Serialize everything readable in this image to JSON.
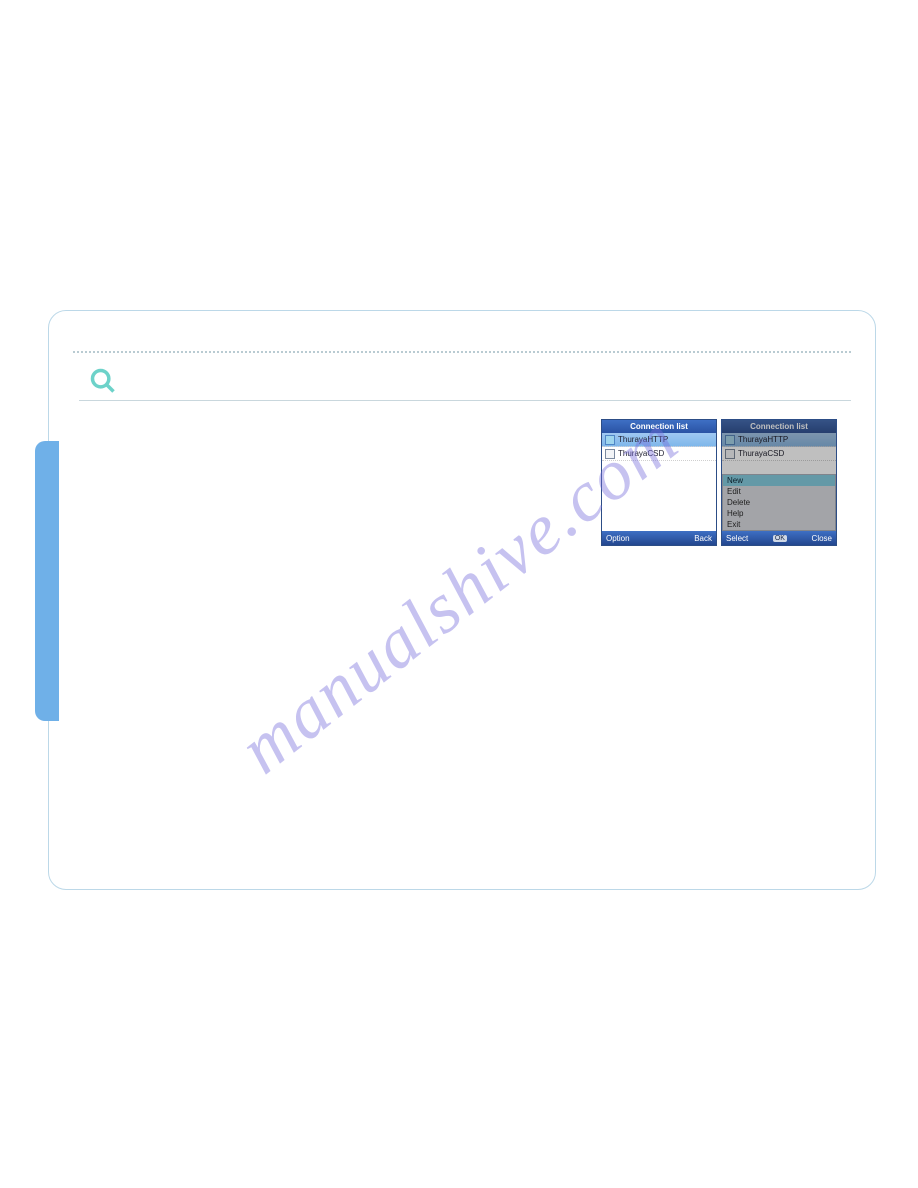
{
  "watermark": "manualshive.com",
  "screenA": {
    "title": "Connection list",
    "items": [
      "ThurayaHTTP",
      "ThurayaCSD"
    ],
    "softLeft": "Option",
    "softRight": "Back"
  },
  "screenB": {
    "title": "Connection list",
    "items": [
      "ThurayaHTTP",
      "ThurayaCSD"
    ],
    "menu": [
      "New",
      "Edit",
      "Delete",
      "Help",
      "Exit"
    ],
    "softLeft": "Select",
    "softMid": "OK",
    "softRight": "Close"
  }
}
